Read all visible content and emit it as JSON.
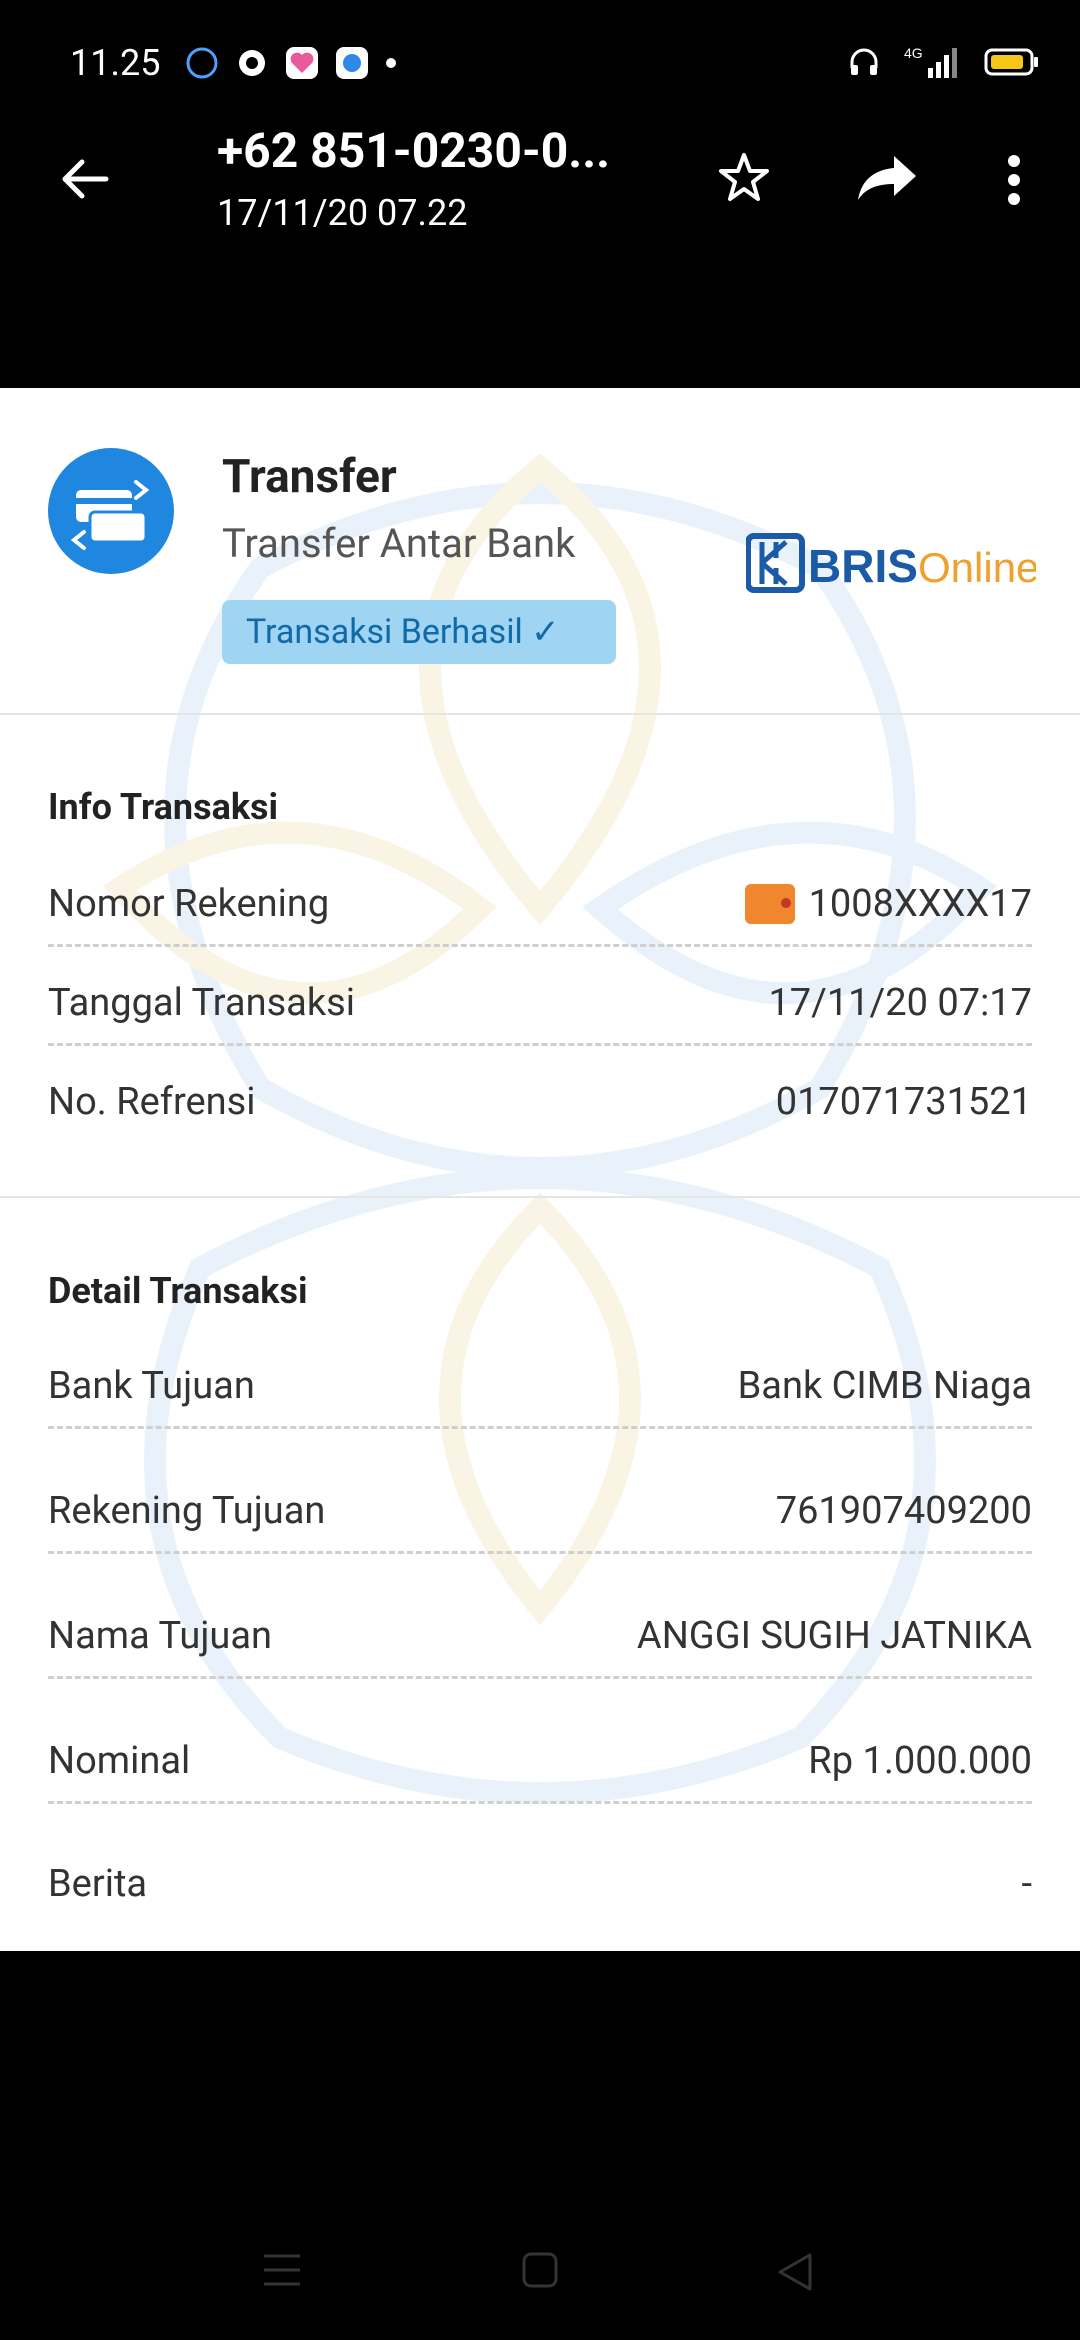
{
  "status_bar": {
    "time": "11.25",
    "network": "4G"
  },
  "app_bar": {
    "title": "+62 851-0230-0...",
    "subtitle": "17/11/20 07.22"
  },
  "receipt": {
    "type_title": "Transfer",
    "type_subtitle": "Transfer Antar Bank",
    "status_badge": "Transaksi Berhasil ✓",
    "brand_logo": "BRISOnline",
    "info_section": {
      "title": "Info Transaksi",
      "rows": [
        {
          "label": "Nomor Rekening",
          "value": "1008XXXX17"
        },
        {
          "label": "Tanggal Transaksi",
          "value": "17/11/20 07:17"
        },
        {
          "label": "No. Refrensi",
          "value": "017071731521"
        }
      ]
    },
    "detail_section": {
      "title": "Detail Transaksi",
      "rows": [
        {
          "label": "Bank Tujuan",
          "value": "Bank CIMB Niaga"
        },
        {
          "label": "Rekening Tujuan",
          "value": "761907409200"
        },
        {
          "label": "Nama Tujuan",
          "value": "ANGGI SUGIH JATNIKA"
        },
        {
          "label": "Nominal",
          "value": "Rp 1.000.000"
        },
        {
          "label": "Berita",
          "value": "-"
        }
      ]
    }
  },
  "colors": {
    "accent": "#1f87e0",
    "badge_bg": "#9fd4f3",
    "badge_text": "#1069a8",
    "bris_blue": "#1a5aa6",
    "bris_orange": "#f0a02d"
  }
}
